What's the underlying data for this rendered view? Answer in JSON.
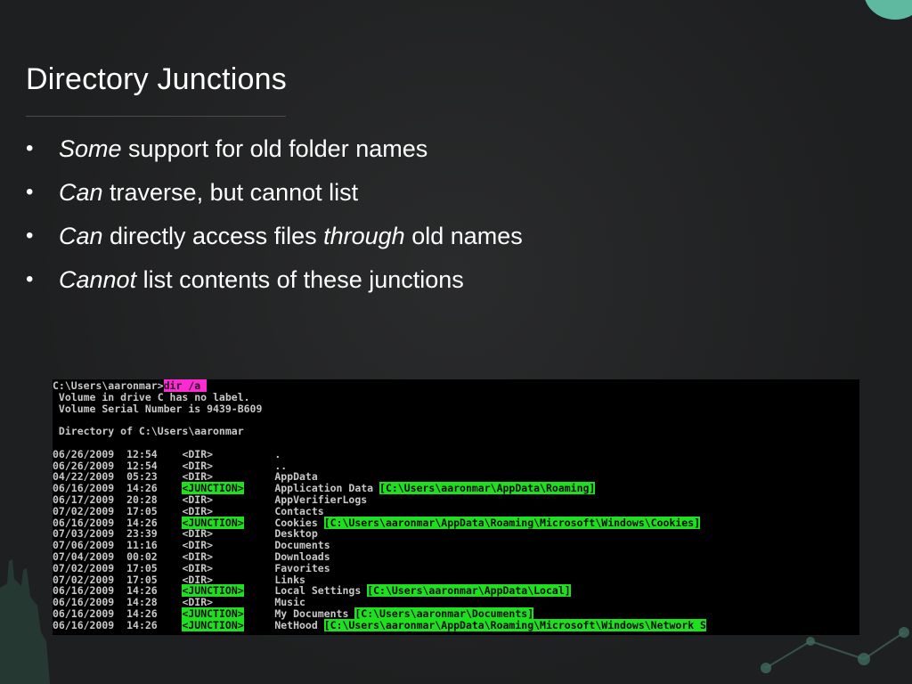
{
  "slide": {
    "title": "Directory Junctions",
    "bullets": [
      {
        "em": "Some",
        "rest": " support for old folder names",
        "em2": "",
        "rest2": ""
      },
      {
        "em": "Can",
        "rest": " traverse, but cannot list",
        "em2": "",
        "rest2": ""
      },
      {
        "em": "Can",
        "rest": " directly access files ",
        "em2": "through",
        "rest2": " old names"
      },
      {
        "em": "Cannot",
        "rest": " list contents of these junctions",
        "em2": "",
        "rest2": ""
      }
    ],
    "bullet_glyph": "•"
  },
  "console": {
    "prompt": "C:\\Users\\aaronmar>",
    "command": "dir /a ",
    "volume_label": " Volume in drive C has no label.",
    "serial": " Volume Serial Number is 9439-B609",
    "directory_of": " Directory of C:\\Users\\aaronmar",
    "entries": [
      {
        "date": "06/26/2009",
        "time": "12:54",
        "type": "<DIR>",
        "junction": false,
        "name": ".",
        "target": ""
      },
      {
        "date": "06/26/2009",
        "time": "12:54",
        "type": "<DIR>",
        "junction": false,
        "name": "..",
        "target": ""
      },
      {
        "date": "04/22/2009",
        "time": "05:23",
        "type": "<DIR>",
        "junction": false,
        "name": "AppData",
        "target": ""
      },
      {
        "date": "06/16/2009",
        "time": "14:26",
        "type": "<JUNCTION>",
        "junction": true,
        "name": "Application Data",
        "target": "[C:\\Users\\aaronmar\\AppData\\Roaming]"
      },
      {
        "date": "06/17/2009",
        "time": "20:28",
        "type": "<DIR>",
        "junction": false,
        "name": "AppVerifierLogs",
        "target": ""
      },
      {
        "date": "07/02/2009",
        "time": "17:05",
        "type": "<DIR>",
        "junction": false,
        "name": "Contacts",
        "target": ""
      },
      {
        "date": "06/16/2009",
        "time": "14:26",
        "type": "<JUNCTION>",
        "junction": true,
        "name": "Cookies",
        "target": "[C:\\Users\\aaronmar\\AppData\\Roaming\\Microsoft\\Windows\\Cookies]"
      },
      {
        "date": "07/03/2009",
        "time": "23:39",
        "type": "<DIR>",
        "junction": false,
        "name": "Desktop",
        "target": ""
      },
      {
        "date": "07/06/2009",
        "time": "11:16",
        "type": "<DIR>",
        "junction": false,
        "name": "Documents",
        "target": ""
      },
      {
        "date": "07/04/2009",
        "time": "00:02",
        "type": "<DIR>",
        "junction": false,
        "name": "Downloads",
        "target": ""
      },
      {
        "date": "07/02/2009",
        "time": "17:05",
        "type": "<DIR>",
        "junction": false,
        "name": "Favorites",
        "target": ""
      },
      {
        "date": "07/02/2009",
        "time": "17:05",
        "type": "<DIR>",
        "junction": false,
        "name": "Links",
        "target": ""
      },
      {
        "date": "06/16/2009",
        "time": "14:26",
        "type": "<JUNCTION>",
        "junction": true,
        "name": "Local Settings",
        "target": "[C:\\Users\\aaronmar\\AppData\\Local]"
      },
      {
        "date": "06/16/2009",
        "time": "14:28",
        "type": "<DIR>",
        "junction": false,
        "name": "Music",
        "target": ""
      },
      {
        "date": "06/16/2009",
        "time": "14:26",
        "type": "<JUNCTION>",
        "junction": true,
        "name": "My Documents",
        "target": "[C:\\Users\\aaronmar\\Documents]"
      },
      {
        "date": "06/16/2009",
        "time": "14:26",
        "type": "<JUNCTION>",
        "junction": true,
        "name": "NetHood",
        "target": "[C:\\Users\\aaronmar\\AppData\\Roaming\\Microsoft\\Windows\\Network S"
      }
    ]
  },
  "colors": {
    "background": "#1e1f20",
    "accent_circle": "#5fb8a0",
    "command_highlight": "#ff29d4",
    "junction_highlight": "#1fe01f"
  }
}
